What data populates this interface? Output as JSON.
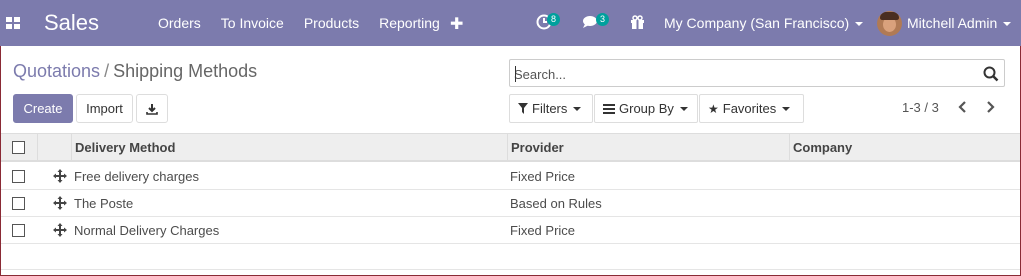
{
  "navbar": {
    "brand": "Sales",
    "menu": [
      "Orders",
      "To Invoice",
      "Products",
      "Reporting"
    ],
    "activity_count": "8",
    "chat_count": "3",
    "company": "My Company (San Francisco)",
    "user": "Mitchell Admin"
  },
  "breadcrumb": {
    "parent": "Quotations",
    "separator": "/",
    "current": "Shipping Methods"
  },
  "search": {
    "placeholder": "Search..."
  },
  "buttons": {
    "create": "Create",
    "import": "Import"
  },
  "filters": {
    "filters": "Filters",
    "group_by": "Group By",
    "favorites": "Favorites"
  },
  "pager": {
    "value": "1-3 / 3"
  },
  "table": {
    "headers": [
      "Delivery Method",
      "Provider",
      "Company"
    ],
    "rows": [
      {
        "method": "Free delivery charges",
        "provider": "Fixed Price",
        "company": ""
      },
      {
        "method": "The Poste",
        "provider": "Based on Rules",
        "company": ""
      },
      {
        "method": "Normal Delivery Charges",
        "provider": "Fixed Price",
        "company": ""
      }
    ]
  },
  "colors": {
    "brand": "#7c7bad",
    "badge": "#00a09d",
    "header_bg": "#eeeeee"
  },
  "icons": {
    "apps": "apps-grid-icon",
    "new": "plus-icon",
    "activity": "clock-icon",
    "messages": "chat-icon",
    "gift": "gift-icon",
    "search": "search-icon",
    "download": "download-icon",
    "filter": "filter-icon",
    "group": "list-icon",
    "favorites": "star-icon",
    "prev": "chevron-left-icon",
    "next": "chevron-right-icon",
    "handle": "move-handle-icon"
  }
}
